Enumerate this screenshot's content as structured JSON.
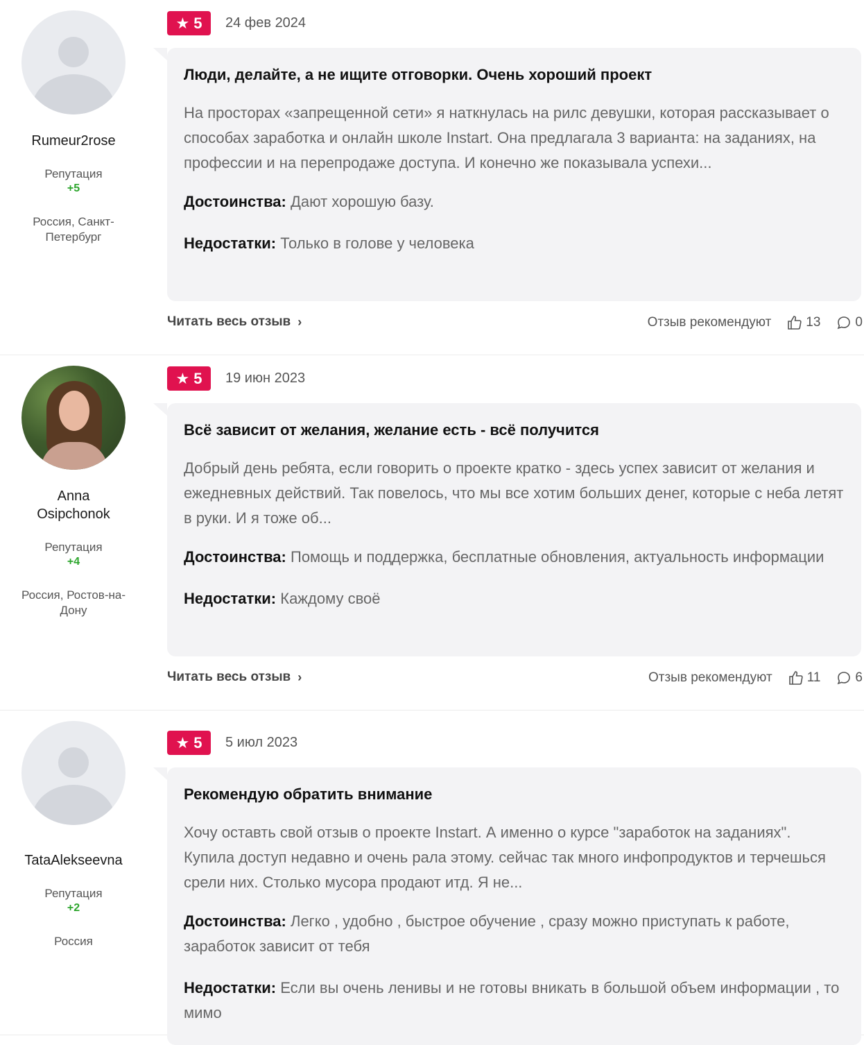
{
  "reviews": [
    {
      "author": {
        "name": "Rumeur2rose",
        "reputation_label": "Репутация",
        "reputation_value": "+5",
        "location": "Россия, Санкт-Петербург",
        "avatar": "default-avatar"
      },
      "rating": "5",
      "date": "24 фев 2024",
      "title": "Люди, делайте, а не ищите отговорки. Очень хороший проект",
      "text": "На просторах «запрещенной сети» я наткнулась на рилс девушки, которая рассказывает о способах заработка и онлайн школе Instart. Она предлагала 3 варианта: на заданиях, на профессии и на перепродаже доступа. И конечно же показывала успехи...",
      "pros_label": "Достоинства:",
      "pros": "Дают хорошую базу.",
      "cons_label": "Недостатки:",
      "cons": "Только в голове у человека",
      "read_more": "Читать весь отзыв",
      "recommend_label": "Отзыв рекомендуют",
      "likes": "13",
      "comments": "0"
    },
    {
      "author": {
        "name": "Anna Osipchonok",
        "reputation_label": "Репутация",
        "reputation_value": "+4",
        "location": "Россия, Ростов-на-Дону",
        "avatar": "user-photo"
      },
      "rating": "5",
      "date": "19 июн 2023",
      "title": "Всё зависит от желания, желание есть - всё получится",
      "text": "Добрый день ребята, если говорить о проекте кратко - здесь успех зависит от желания и ежедневных действий. Так повелось, что мы все хотим больших денег, которые с неба летят в руки. И я тоже об...",
      "pros_label": "Достоинства:",
      "pros": "Помощь и поддержка, бесплатные обновления, актуальность информации",
      "cons_label": "Недостатки:",
      "cons": "Каждому своё",
      "read_more": "Читать весь отзыв",
      "recommend_label": "Отзыв рекомендуют",
      "likes": "11",
      "comments": "6"
    },
    {
      "author": {
        "name": "TataAlekseevna",
        "reputation_label": "Репутация",
        "reputation_value": "+2",
        "location": "Россия",
        "avatar": "default-avatar"
      },
      "rating": "5",
      "date": "5 июл 2023",
      "title": "Рекомендую обратить внимание",
      "text": "Хочу оставть свой отзыв о проекте Instart. А именно о курсе \"заработок на заданиях\". Купила доступ недавно и очень рала этому. сейчас так много инфопродуктов и терчешься срели них. Столько мусора продают итд. Я не...",
      "pros_label": "Достоинства:",
      "pros": "Легко , удобно , быстрое обучение , сразу можно приступать к работе, заработок зависит от тебя",
      "cons_label": "Недостатки:",
      "cons": "Если вы очень ленивы и не готовы вникать в большой объем информации , то мимо"
    }
  ],
  "colors": {
    "rating_badge": "#e0124f",
    "reputation_positive": "#2ca52c",
    "card_bg": "#f3f3f5"
  }
}
